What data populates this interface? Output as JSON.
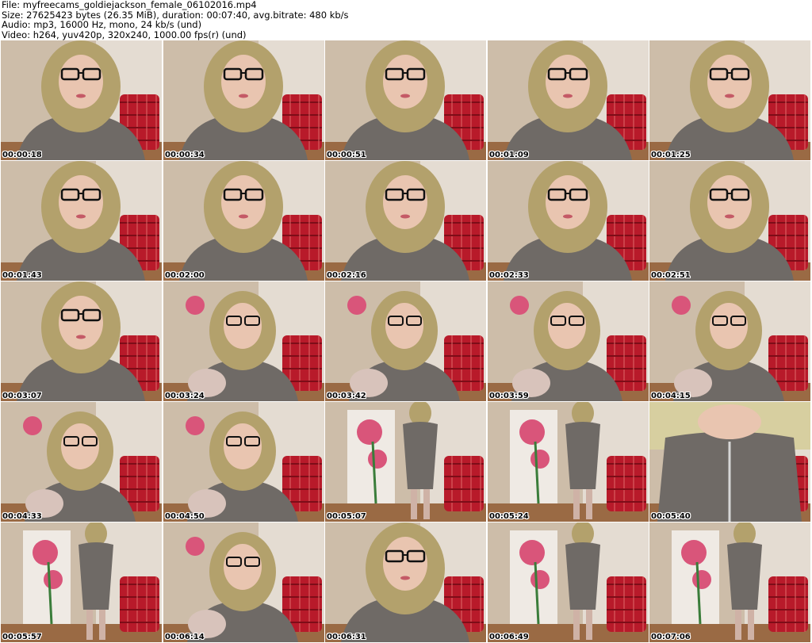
{
  "header": {
    "file_line": "File: myfreecams_goldiejackson_female_06102016.mp4",
    "size_line": "Size: 27625423 bytes (26.35 MiB), duration: 00:07:40, avg.bitrate: 480 kb/s",
    "audio_line": "Audio: mp3, 16000 Hz, mono, 24 kb/s (und)",
    "video_line": "Video: h264, yuv420p, 320x240, 1000.00 fps(r) (und)"
  },
  "thumbnails": [
    {
      "timestamp": "00:00:18",
      "scene": "closeup"
    },
    {
      "timestamp": "00:00:34",
      "scene": "closeup"
    },
    {
      "timestamp": "00:00:51",
      "scene": "closeup"
    },
    {
      "timestamp": "00:01:09",
      "scene": "closeup"
    },
    {
      "timestamp": "00:01:25",
      "scene": "closeup"
    },
    {
      "timestamp": "00:01:43",
      "scene": "closeup"
    },
    {
      "timestamp": "00:02:00",
      "scene": "closeup"
    },
    {
      "timestamp": "00:02:16",
      "scene": "closeup"
    },
    {
      "timestamp": "00:02:33",
      "scene": "closeup"
    },
    {
      "timestamp": "00:02:51",
      "scene": "closeup"
    },
    {
      "timestamp": "00:03:07",
      "scene": "closeup"
    },
    {
      "timestamp": "00:03:24",
      "scene": "seated"
    },
    {
      "timestamp": "00:03:42",
      "scene": "seated"
    },
    {
      "timestamp": "00:03:59",
      "scene": "seated"
    },
    {
      "timestamp": "00:04:15",
      "scene": "seated"
    },
    {
      "timestamp": "00:04:33",
      "scene": "seated"
    },
    {
      "timestamp": "00:04:50",
      "scene": "seated"
    },
    {
      "timestamp": "00:05:07",
      "scene": "standing"
    },
    {
      "timestamp": "00:05:24",
      "scene": "standing"
    },
    {
      "timestamp": "00:05:40",
      "scene": "torso"
    },
    {
      "timestamp": "00:05:57",
      "scene": "standing"
    },
    {
      "timestamp": "00:06:14",
      "scene": "seated"
    },
    {
      "timestamp": "00:06:31",
      "scene": "closeup"
    },
    {
      "timestamp": "00:06:49",
      "scene": "standing"
    },
    {
      "timestamp": "00:07:06",
      "scene": "standing"
    }
  ],
  "colors": {
    "wall": "#cdbda9",
    "chair_red": "#b81a2a",
    "hair": "#b3a16c",
    "skin": "#e9c5b0",
    "dress": "#6f6a66",
    "floor": "#9a6a44",
    "rose": "#d9557a"
  }
}
